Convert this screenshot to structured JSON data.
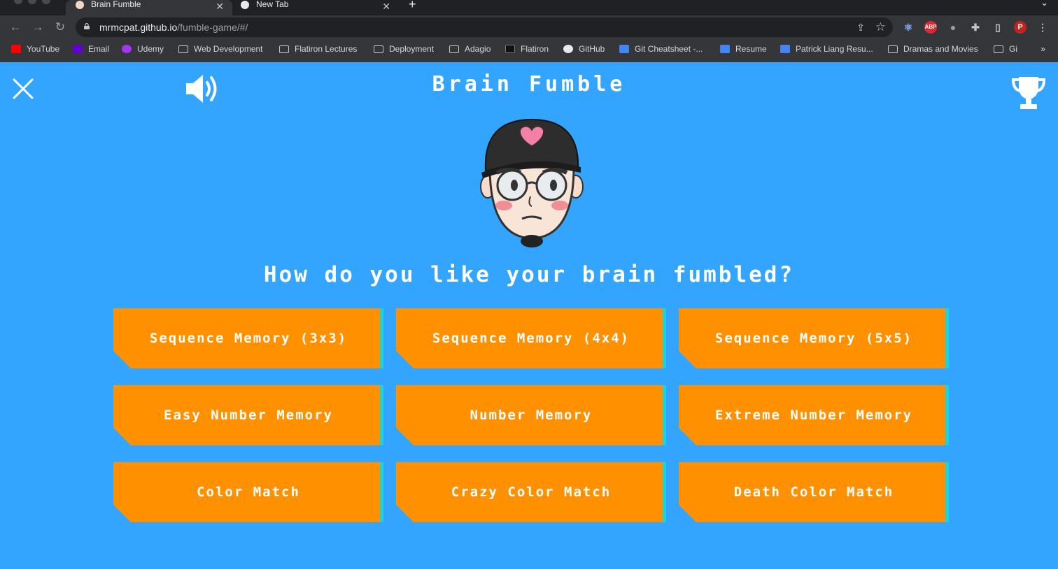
{
  "browser": {
    "tabs": [
      {
        "title": "Brain Fumble",
        "active": true
      },
      {
        "title": "New Tab",
        "active": false
      }
    ],
    "url_host": "mrmcpat.github.io",
    "url_path": "/fumble-game/#/",
    "profile_initial": "P",
    "bookmarks": [
      {
        "label": "YouTube",
        "icon": "youtube-icon"
      },
      {
        "label": "Email",
        "icon": "email-icon"
      },
      {
        "label": "Udemy",
        "icon": "udemy-icon"
      },
      {
        "label": "Web Development",
        "icon": "folder-icon"
      },
      {
        "label": "Flatiron Lectures",
        "icon": "folder-icon"
      },
      {
        "label": "Deployment",
        "icon": "folder-icon"
      },
      {
        "label": "Adagio",
        "icon": "folder-icon"
      },
      {
        "label": "Flatiron",
        "icon": "flatiron-icon"
      },
      {
        "label": "GitHub",
        "icon": "github-icon"
      },
      {
        "label": "Git Cheatsheet -...",
        "icon": "doc-icon"
      },
      {
        "label": "Resume",
        "icon": "doc-icon"
      },
      {
        "label": "Patrick Liang Resu...",
        "icon": "doc-icon"
      },
      {
        "label": "Dramas and Movies",
        "icon": "folder-icon"
      },
      {
        "label": "Gi",
        "icon": "folder-icon"
      }
    ],
    "bookmarks_more": "»"
  },
  "game": {
    "title": "Brain Fumble",
    "question": "How do you like your brain fumbled?",
    "modes": [
      "Sequence Memory (3x3)",
      "Sequence Memory (4x4)",
      "Sequence Memory (5x5)",
      "Easy Number Memory",
      "Number Memory",
      "Extreme Number Memory",
      "Color Match",
      "Crazy Color Match",
      "Death Color Match"
    ]
  },
  "colors": {
    "page_background": "#33A5FF",
    "button": "#FF9100",
    "button_edge": "#19D3E3",
    "text": "#FFFFFF"
  }
}
